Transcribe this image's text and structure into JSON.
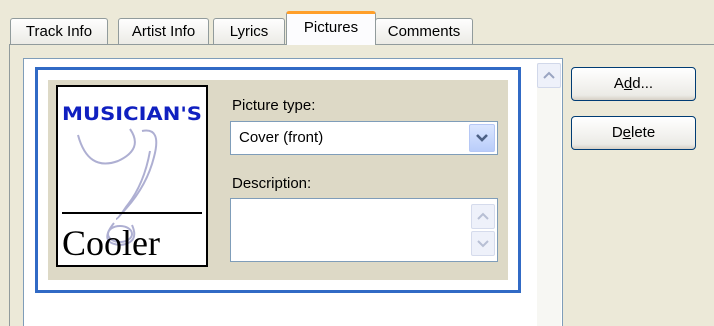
{
  "tabs": [
    {
      "label": "Track Info"
    },
    {
      "label": "Artist Info"
    },
    {
      "label": "Lyrics"
    },
    {
      "label": "Pictures",
      "active": true
    },
    {
      "label": "Comments"
    }
  ],
  "picture_entry": {
    "thumbnail": {
      "top_text": "MUSICIAN'S",
      "bottom_text": "Cooler"
    },
    "picture_type_label": "Picture type:",
    "picture_type_value": "Cover (front)",
    "description_label": "Description:",
    "description_value": ""
  },
  "buttons": {
    "add_pre": "A",
    "add_key": "d",
    "add_post": "d...",
    "delete_pre": "D",
    "delete_key": "e",
    "delete_post": "lete"
  },
  "colors": {
    "active_tab_accent": "#ff9f2a",
    "selection_border": "#316ac5",
    "entry_background": "#ddd9c6",
    "logo_blue": "#1020c0",
    "window_background": "#ece9d8"
  },
  "icons": [
    "chevron-down-icon",
    "scroll-up-arrow-icon",
    "scroll-down-arrow-icon"
  ]
}
